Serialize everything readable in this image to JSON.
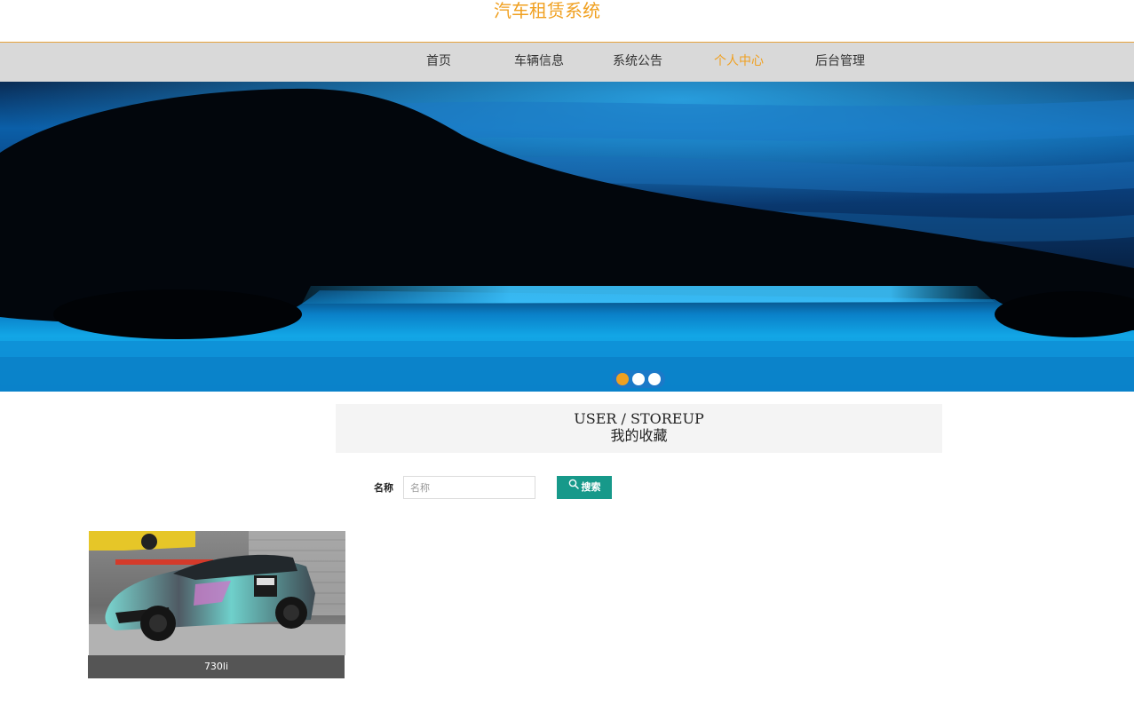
{
  "header": {
    "site_title": "汽车租赁系统",
    "title_color": "#f0a020"
  },
  "nav": {
    "items": [
      {
        "label": "首页",
        "active": false
      },
      {
        "label": "车辆信息",
        "active": false
      },
      {
        "label": "系统公告",
        "active": false
      },
      {
        "label": "个人中心",
        "active": true
      },
      {
        "label": "后台管理",
        "active": false
      }
    ],
    "active_color": "#f0a020"
  },
  "banner": {
    "image": "dark car silhouette on blue background",
    "slides": 3,
    "active_slide": 1
  },
  "section": {
    "title_en": "USER / STOREUP",
    "title_zh": "我的收藏"
  },
  "search": {
    "label": "名称",
    "placeholder": "名称",
    "value": "",
    "button_label": "搜索",
    "button_icon": "search-icon",
    "button_color": "#17998a"
  },
  "favorites": [
    {
      "name": "730li",
      "image": "wrapped Honda Civic Type R in garage"
    }
  ]
}
